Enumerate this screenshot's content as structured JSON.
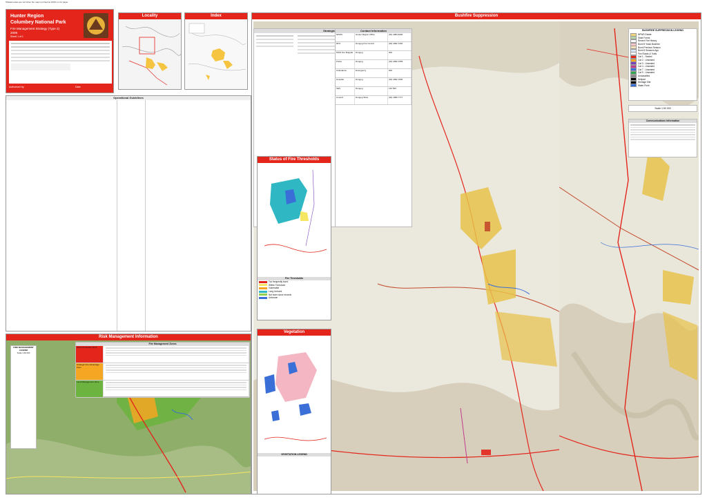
{
  "note": "Shaded areas are red when fire map is printed at 100% on A1 paper",
  "header": {
    "region": "Hunter Region",
    "park": "Columbey National Park",
    "strategy": "Fire Management Strategy (Type 2)",
    "year": "2009",
    "sheet": "Sheet 1 of 1",
    "approved_label": "Authorised by:",
    "date_label": "Date:"
  },
  "panels": {
    "locality": "Locality",
    "index": "Index",
    "bushfire": "Bushfire Suppression",
    "risk": "Risk Management Information",
    "thresholds": "Status of Fire Thresholds",
    "vegetation": "Vegetation",
    "strategic_zone": "Strategic Zone",
    "fire_thresholds": "Fire Thresholds",
    "fire_management_zones": "Fire Management Zones",
    "operational_guidelines": "Operational Guidelines",
    "contact_information": "Contact Information",
    "communications": "Communications Information",
    "legend_title": "BUSHFIRE SUPPRESSION LEGEND",
    "vegetation_legend": "VEGETATION LEGEND",
    "risk_legend": "FIRE MANAGEMENT LEGEND",
    "scale": "Scale 1:50 000",
    "scale_small": "Scale 1:60 000"
  },
  "zones": [
    {
      "name": "Asset Protection Zone",
      "color": "#e3251c"
    },
    {
      "name": "Strategic Fire Advantage Zone",
      "color": "#f5a623"
    },
    {
      "name": "Land Management Zone",
      "color": "#6db33f"
    }
  ],
  "threshold_status": [
    {
      "name": "Too frequently burnt",
      "color": "#e3251c"
    },
    {
      "name": "Within Threshold",
      "color": "#f5e663"
    },
    {
      "name": "Vulnerable",
      "color": "#f5a623"
    },
    {
      "name": "Long Unburnt",
      "color": "#2fb8c4"
    },
    {
      "name": "Not burnt since records",
      "color": "#8fd14f"
    },
    {
      "name": "Unknown",
      "color": "#3a6fd8"
    }
  ],
  "legend": [
    {
      "label": "NPWS Estate",
      "color": "#f2d77a"
    },
    {
      "label": "State Forest",
      "color": "#b7d7a8"
    },
    {
      "label": "Recent Fire History",
      "color": "#ffffff"
    },
    {
      "label": "Burnt 5 Years Bushfire",
      "color": "#f7c6c6"
    },
    {
      "label": "Burnt Previous Season",
      "color": "#f9e0b8"
    },
    {
      "label": "Burnt 5 Seasons Ago",
      "color": "#dbe9f7"
    },
    {
      "label": "Fire Roads & Trails",
      "color": "#ffffff"
    },
    {
      "label": "Cat 1 - Sealed",
      "color": "#e3251c"
    },
    {
      "label": "Cat 2 - Unsealed",
      "color": "#f5a623"
    },
    {
      "label": "Cat 3 - Unsealed",
      "color": "#7a3fb8"
    },
    {
      "label": "Cat 4 - Unsealed",
      "color": "#c0398a"
    },
    {
      "label": "Cat 7 - Unsealed",
      "color": "#3a6fd8"
    },
    {
      "label": "Cat 9 - Unsealed",
      "color": "#2fa84f"
    },
    {
      "label": "Unclassified",
      "color": "#888888"
    },
    {
      "label": "Helipad",
      "color": "#000000"
    },
    {
      "label": "Heritage Site",
      "color": "#000000"
    },
    {
      "label": "Water Point",
      "color": "#3a6fd8"
    }
  ],
  "guidelines_header": "Operational Guidelines",
  "contact_header": "Agency",
  "contacts": [
    {
      "agency": "NPWS",
      "name": "Hunter Region Office",
      "phone": "(02) 4984 8200"
    },
    {
      "agency": "RFS",
      "name": "Dungog Fire Control",
      "phone": "(02) 4992 1166"
    },
    {
      "agency": "NSW Fire Brigade",
      "name": "Dungog",
      "phone": "000"
    },
    {
      "agency": "Police",
      "name": "Dungog",
      "phone": "(02) 4992 1055"
    },
    {
      "agency": "Ambulance",
      "name": "Emergency",
      "phone": "000"
    },
    {
      "agency": "Hospital",
      "name": "Dungog",
      "phone": "(02) 4992 1500"
    },
    {
      "agency": "SES",
      "name": "Dungog",
      "phone": "132 500"
    },
    {
      "agency": "Council",
      "name": "Dungog Shire",
      "phone": "(02) 4995 7777"
    }
  ]
}
